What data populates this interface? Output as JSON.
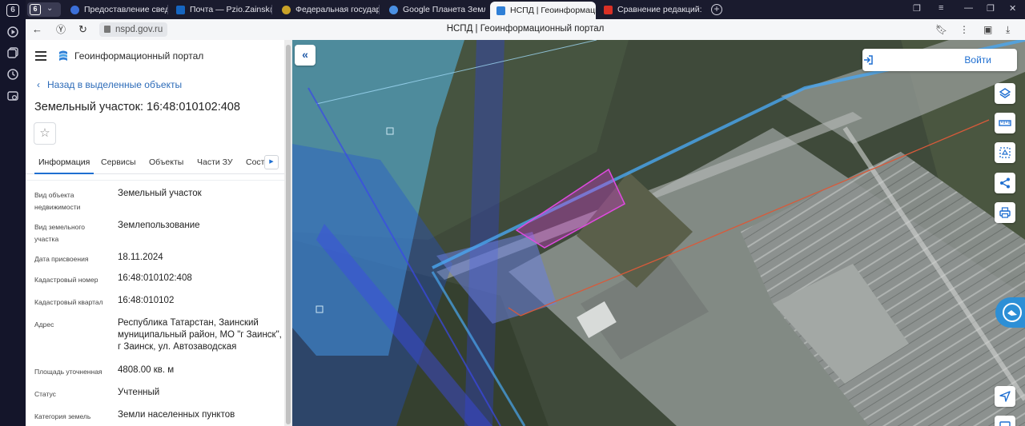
{
  "browser": {
    "rail_badge": "6",
    "workspace_badge": "6",
    "tabs": [
      {
        "label": "Предоставление сведени",
        "favicon_color": "#3b6fd8"
      },
      {
        "label": "Почта — Pzio.Zainsk@tata",
        "favicon_color": "#1565c0"
      },
      {
        "label": "Федеральная государстве",
        "favicon_color": "#c9a227"
      },
      {
        "label": "Google Планета Земля",
        "favicon_color": "#4a90e2"
      },
      {
        "label": "НСПД | Геоинформаци",
        "favicon_color": "#2f7fd6",
        "active": true
      },
      {
        "label": "Сравнение редакций: Пол",
        "favicon_color": "#d93025"
      }
    ],
    "url": "nspd.gov.ru",
    "page_title": "НСПД | Геоинформационный портал"
  },
  "panel": {
    "app_title": "Геоинформационный портал",
    "back_link": "Назад в выделенные объекты",
    "object_title": "Земельный участок: 16:48:010102:408",
    "tabs": [
      "Информация",
      "Сервисы",
      "Объекты",
      "Части ЗУ",
      "Состав"
    ],
    "fields": [
      {
        "key": "Вид объекта недвижимости",
        "value": "Земельный участок"
      },
      {
        "key": "Вид земельного участка",
        "value": "Землепользование"
      },
      {
        "key": "Дата присвоения",
        "value": "18.11.2024"
      },
      {
        "key": "Кадастровый номер",
        "value": "16:48:010102:408"
      },
      {
        "key": "Кадастровый квартал",
        "value": "16:48:010102"
      },
      {
        "key": "Адрес",
        "value": "Республика Татарстан, Заинский муниципальный район, МО \"г Заинск\", г Заинск, ул. Автозаводская"
      },
      {
        "key": "Площадь уточненная",
        "value": "4808.00 кв. м"
      },
      {
        "key": "Статус",
        "value": "Учтенный"
      },
      {
        "key": "Категория земель",
        "value": "Земли населенных пунктов"
      }
    ]
  },
  "map": {
    "login_label": "Войти",
    "accent": "#1f6fd1",
    "parcel_color": "#d63cd6"
  }
}
